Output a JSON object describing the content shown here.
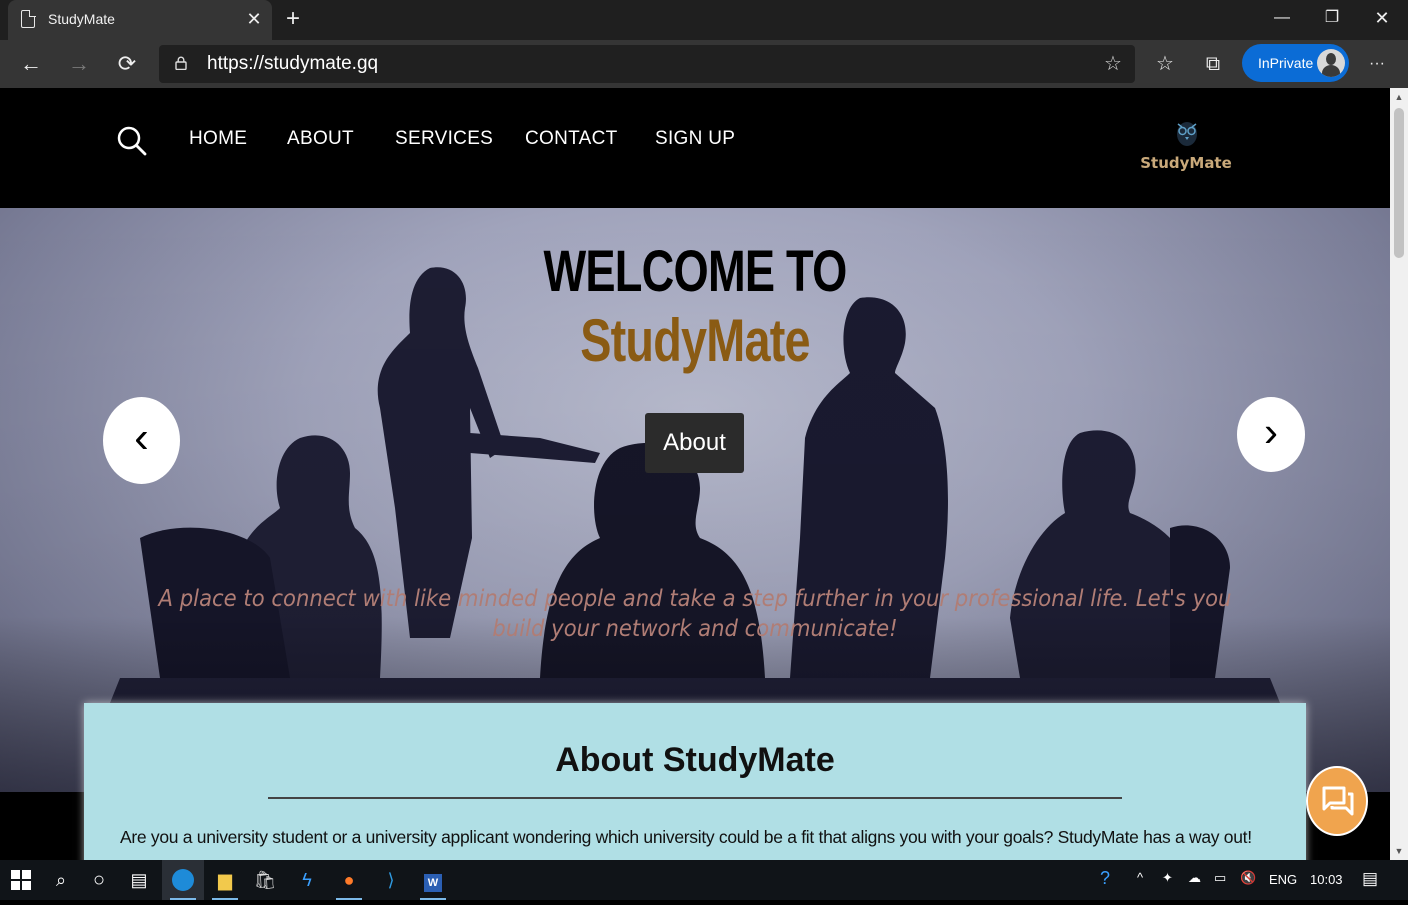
{
  "browser": {
    "tab_title": "StudyMate",
    "tab_close": "✕",
    "new_tab": "+",
    "url_scheme": "https://",
    "url_domain": "studymate.gq",
    "inprivate_label": "InPrivate",
    "more": "···"
  },
  "site": {
    "nav": [
      "HOME",
      "ABOUT",
      "SERVICES",
      "CONTACT",
      "SIGN UP"
    ],
    "logo_text": "StudyMate",
    "hero": {
      "title_line1": "WELCOME TO",
      "title_line2": "StudyMate",
      "about_button": "About",
      "prev": "‹",
      "next": "›",
      "tagline": "A place to connect with like minded people and take a step further in your professional life. Let's you build your network and communicate!"
    },
    "about": {
      "heading": "About StudyMate",
      "text": "Are you a university student or a university applicant wondering which university could be a fit that aligns you with your goals? StudyMate has a way out!"
    }
  },
  "taskbar": {
    "language": "ENG",
    "time": "10:03"
  },
  "colors": {
    "accent_title": "#8a5b14",
    "about_card": "#b0dfe5",
    "chat_fab": "#f0a44e",
    "inprivate": "#0b6cd6"
  }
}
